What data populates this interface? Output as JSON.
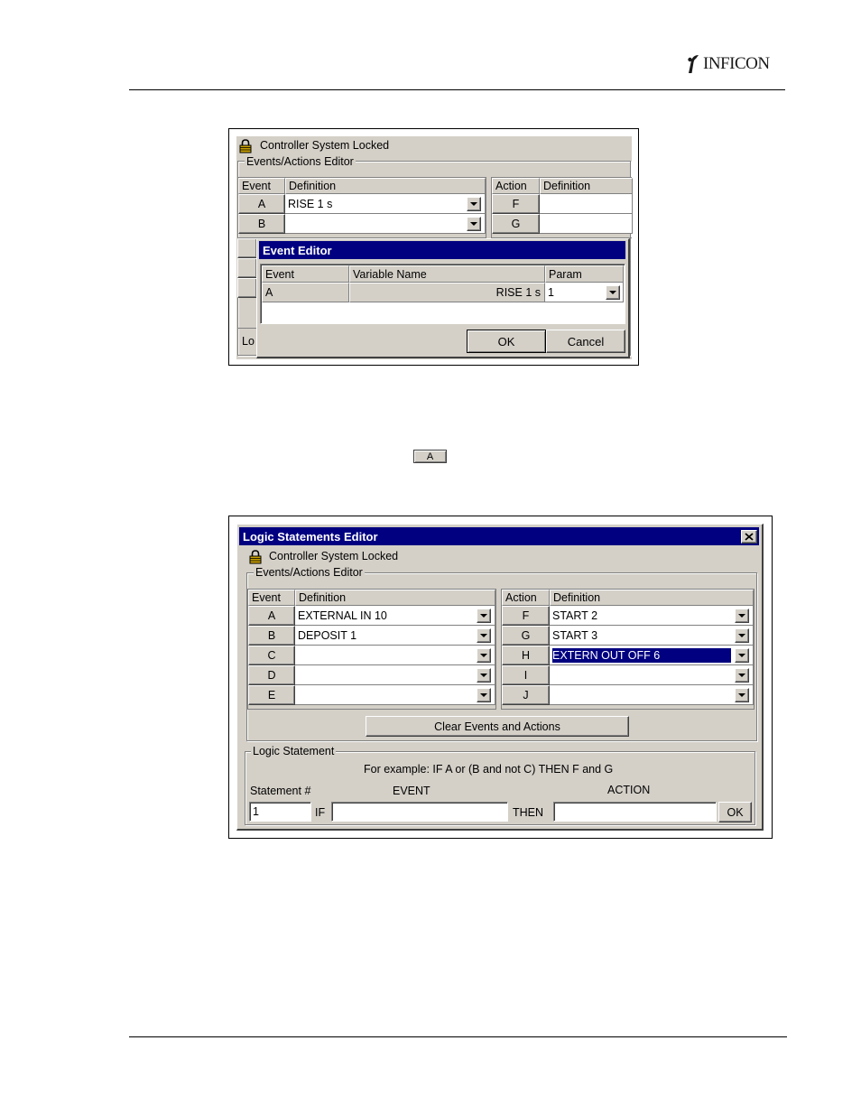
{
  "header": {
    "logo_text": "INFICON"
  },
  "screenshot1": {
    "lock_label": "Controller System Locked",
    "group_label": "Events/Actions Editor",
    "event_header": "Event",
    "definition_header": "Definition",
    "action_header": "Action",
    "action_definition_header": "Definition",
    "events": [
      {
        "label": "A",
        "definition": "RISE 1 s"
      },
      {
        "label": "B",
        "definition": ""
      }
    ],
    "actions": [
      {
        "label": "F",
        "definition": ""
      },
      {
        "label": "G",
        "definition": ""
      }
    ],
    "truncated_label": "Lo",
    "dialog": {
      "title": "Event Editor",
      "col_event": "Event",
      "col_variable": "Variable Name",
      "col_param": "Param",
      "row_event": "A",
      "row_variable": "RISE 1 s",
      "row_param": "1",
      "ok": "OK",
      "cancel": "Cancel"
    }
  },
  "inline_button": {
    "label": "A"
  },
  "screenshot2": {
    "title": "Logic Statements Editor",
    "lock_label": "Controller System Locked",
    "group_label": "Events/Actions Editor",
    "event_header": "Event",
    "definition_header": "Definition",
    "action_header": "Action",
    "action_definition_header": "Definition",
    "events": [
      {
        "label": "A",
        "definition": "EXTERNAL IN 10"
      },
      {
        "label": "B",
        "definition": "DEPOSIT 1"
      },
      {
        "label": "C",
        "definition": ""
      },
      {
        "label": "D",
        "definition": ""
      },
      {
        "label": "E",
        "definition": ""
      }
    ],
    "actions": [
      {
        "label": "F",
        "definition": "START 2"
      },
      {
        "label": "G",
        "definition": "START 3"
      },
      {
        "label": "H",
        "definition": "EXTERN OUT OFF 6"
      },
      {
        "label": "I",
        "definition": ""
      },
      {
        "label": "J",
        "definition": ""
      }
    ],
    "clear_button": "Clear Events and Actions",
    "logic_group_label": "Logic Statement",
    "example_text": "For example: IF A or (B and not C) THEN F and G",
    "statement_label": "Statement #",
    "event_label": "EVENT",
    "action_label": "ACTION",
    "statement_value": "1",
    "if_label": "IF",
    "then_label": "THEN",
    "event_value": "",
    "action_value": "",
    "ok": "OK"
  }
}
